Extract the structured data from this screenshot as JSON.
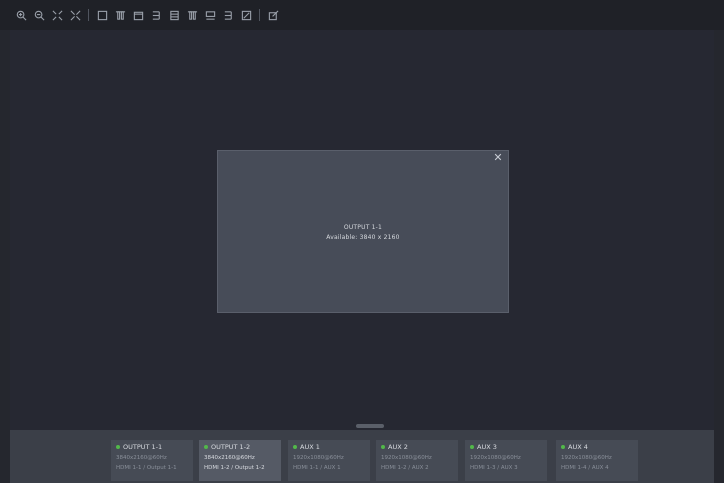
{
  "window": {
    "title": "OUTPUT 1-1",
    "subtitle": "Available: 3840 x 2160"
  },
  "cards": [
    {
      "name": "OUTPUT 1-1",
      "line1": "3840x2160@60Hz",
      "line2": "HDMI 1-1 / Output 1-1"
    },
    {
      "name": "OUTPUT 1-2",
      "line1": "3840x2160@60Hz",
      "line2": "HDMI 1-2 / Output 1-2"
    },
    {
      "name": "AUX 1",
      "line1": "1920x1080@60Hz",
      "line2": "HDMI 1-1 / AUX 1"
    },
    {
      "name": "AUX 2",
      "line1": "1920x1080@60Hz",
      "line2": "HDMI 1-2 / AUX 2"
    },
    {
      "name": "AUX 3",
      "line1": "1920x1080@60Hz",
      "line2": "HDMI 1-3 / AUX 3"
    },
    {
      "name": "AUX 4",
      "line1": "1920x1080@60Hz",
      "line2": "HDMI 1-4 / AUX 4"
    }
  ],
  "icons": {
    "zoom_in": "zoom-in-icon",
    "zoom_out": "zoom-out-icon",
    "fit": "fit-screen-icon",
    "collapse": "collapse-icon",
    "align_left": "align-left-icon",
    "align_center_h": "align-center-horizontal-icon",
    "align_right": "align-right-icon",
    "align_top": "align-top-icon",
    "align_middle": "align-middle-icon",
    "align_bottom": "align-bottom-icon",
    "distribute_h": "distribute-horizontal-icon",
    "distribute_v": "distribute-vertical-icon",
    "fullscreen": "fullscreen-icon",
    "edit": "edit-icon"
  },
  "colors": {
    "background": "#25272e",
    "window": "#474c58",
    "status_dot": "#52b84a",
    "card": "#464b55",
    "card_active": "#555a65"
  }
}
